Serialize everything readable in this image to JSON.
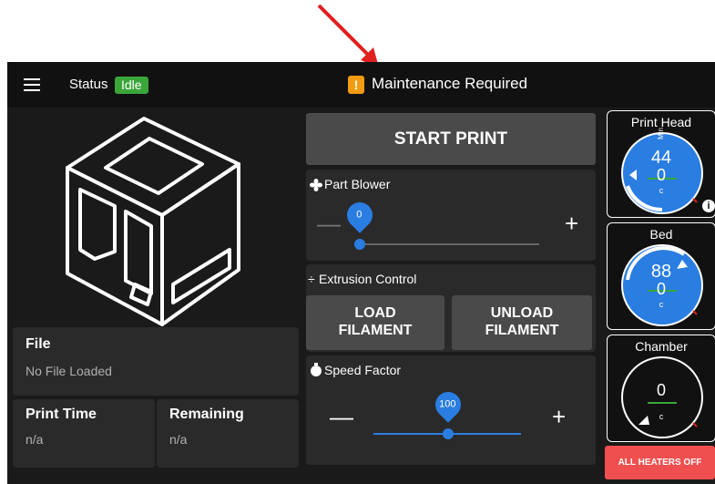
{
  "header": {
    "status_label": "Status",
    "status_value": "Idle",
    "maintenance_icon": "!",
    "maintenance_text": "Maintenance Required"
  },
  "file": {
    "label": "File",
    "value": "No File Loaded"
  },
  "print_time": {
    "label": "Print Time",
    "value": "n/a"
  },
  "remaining": {
    "label": "Remaining",
    "value": "n/a"
  },
  "start_print": "START PRINT",
  "part_blower": {
    "label": "Part Blower",
    "value": "0",
    "level_percent": 0
  },
  "extrusion": {
    "label": "Extrusion Control",
    "load": "LOAD FILAMENT",
    "load_1": "LOAD",
    "load_2": "FILAMENT",
    "unload_1": "UNLOAD",
    "unload_2": "FILAMENT"
  },
  "speed_factor": {
    "label": "Speed Factor",
    "value": "100"
  },
  "gauges": {
    "print_head": {
      "title": "Print Head",
      "current": "44",
      "target": "0",
      "unit": "c",
      "side_label": "Min"
    },
    "bed": {
      "title": "Bed",
      "current": "88",
      "target": "0",
      "unit": "c"
    },
    "chamber": {
      "title": "Chamber",
      "current": "0",
      "unit": "c"
    }
  },
  "all_heaters_off": "ALL HEATERS OFF",
  "colors": {
    "accent_blue": "#2a7de1",
    "idle_green": "#3aa63a",
    "maintenance_orange": "#f39c12",
    "heaters_red": "#ef4f4f"
  },
  "icons": [
    "menu-icon",
    "maintenance-warning-icon",
    "fan-icon",
    "extrusion-icon",
    "stopwatch-icon",
    "info-icon",
    "printer-icon"
  ]
}
